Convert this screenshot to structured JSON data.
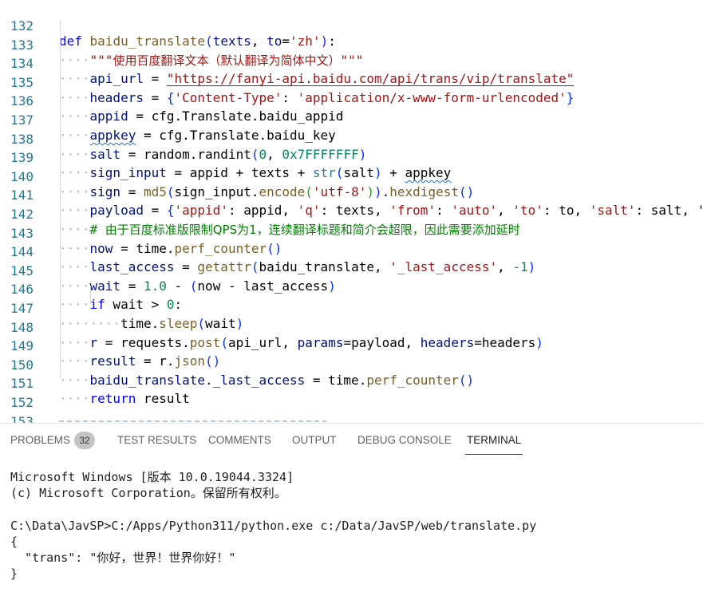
{
  "editor": {
    "line_numbers": [
      "132",
      "133",
      "134",
      "135",
      "136",
      "137",
      "138",
      "139",
      "140",
      "141",
      "142",
      "143",
      "144",
      "145",
      "146",
      "147",
      "148",
      "149",
      "150",
      "151",
      "152",
      "153"
    ],
    "code": {
      "l132": {
        "def": "def",
        "fname": "baidu_translate",
        "open": "(",
        "p1": "texts",
        ", ": ", ",
        "p2": "to",
        "eq": "=",
        "s": "'zh'",
        "close": ")",
        "colon": ":"
      },
      "l133": {
        "q1": "\"\"\"",
        "text": "使用百度翻译文本（默认翻译为简体中文）",
        "q2": "\"\"\""
      },
      "l134": {
        "var": "api_url",
        "op": " = ",
        "s": "\"https://fanyi-api.baidu.com/api/trans/vip/translate\""
      },
      "l135": {
        "var": "headers",
        "op": " = ",
        "ob": "{",
        "k": "'Content-Type'",
        "c": ": ",
        "v": "'application/x-www-form-urlencoded'",
        "cb": "}"
      },
      "l136": {
        "var": "appid",
        "op": " = ",
        "obj": "cfg.Translate.baidu_appid"
      },
      "l137": {
        "var": "appkey",
        "op": " = ",
        "obj": "cfg.Translate.baidu_key"
      },
      "l138": {
        "var": "salt",
        "op": " = ",
        "call": "random.randint",
        "ob": "(",
        "n1": "0",
        ", ": ", ",
        "n2": "0x7FFFFFFF",
        "cb": ")"
      },
      "l139": {
        "var": "sign_input",
        "op": " = ",
        "a": "appid + texts + ",
        "bi": "str",
        "ob": "(",
        "arg": "salt",
        "cb": ")",
        " + ": " + ",
        "b": "appkey"
      },
      "l140": {
        "var": "sign",
        "op": " = ",
        "fn": "md5",
        "o1": "(",
        "x": "sign_input.",
        "fn2": "encode",
        "o2": "(",
        "s": "'utf-8'",
        "c2": ")",
        "c1": ")",
        ".": ".",
        "fn3": "hexdigest",
        "o3": "()"
      },
      "l141": {
        "var": "payload",
        "op": " = ",
        "ob": "{",
        "k1": "'appid'",
        "r1": ": appid, ",
        "k2": "'q'",
        "r2": ": texts, ",
        "k3": "'from'",
        "r3": ": ",
        "v3": "'auto'",
        "r4": ", ",
        "k4": "'to'",
        "r5": ": to, ",
        "k5": "'salt'",
        "r6": ": salt, '"
      },
      "l142": {
        "hash": "# ",
        "text": "由于百度标准版限制QPS为1，连续翻译标题和简介会超限，因此需要添加延时"
      },
      "l143": {
        "var": "now",
        "op": " = ",
        "obj": "time.",
        "fn": "perf_counter",
        "p": "()"
      },
      "l144": {
        "var": "last_access",
        "op": " = ",
        "fn": "getattr",
        "ob": "(",
        "a": "baidu_translate, ",
        "s": "'_last_access'",
        ", ": ", ",
        "n": "-1",
        "cb": ")"
      },
      "l145": {
        "var": "wait",
        "op": " = ",
        "n": "1.0",
        " - ": " - ",
        "ob": "(",
        "a": "now - last_access",
        "cb": ")"
      },
      "l146": {
        "kw": "if",
        "a": " wait > ",
        "n": "0",
        "colon": ":"
      },
      "l147": {
        "obj": "time.",
        "fn": "sleep",
        "ob": "(",
        "a": "wait",
        "cb": ")"
      },
      "l148": {
        "var": "r",
        "op": " = ",
        "obj": "requests.",
        "fn": "post",
        "ob": "(",
        "a": "api_url, ",
        "p1": "params",
        "e1": "=payload, ",
        "p2": "headers",
        "e2": "=headers",
        "cb": ")"
      },
      "l149": {
        "var": "result",
        "op": " = ",
        "obj": "r.",
        "fn": "json",
        "p": "()"
      },
      "l150": {
        "var": "baidu_translate._last_access",
        "op": " = ",
        "obj": "time.",
        "fn": "perf_counter",
        "p": "()"
      },
      "l151": {
        "kw": "return",
        "a": " result"
      }
    }
  },
  "panel": {
    "tabs": [
      {
        "label": "PROBLEMS",
        "badge": "32"
      },
      {
        "label": "TEST RESULTS"
      },
      {
        "label": "COMMENTS"
      },
      {
        "label": "OUTPUT"
      },
      {
        "label": "DEBUG CONSOLE"
      },
      {
        "label": "TERMINAL",
        "active": true
      }
    ]
  },
  "terminal": {
    "lines": [
      "Microsoft Windows [版本 10.0.19044.3324]",
      "(c) Microsoft Corporation。保留所有权利。",
      "",
      "C:\\Data\\JavSP>C:/Apps/Python311/python.exe c:/Data/JavSP/web/translate.py",
      "{",
      "  \"trans\": \"你好，世界！世界你好！\"",
      "}"
    ]
  },
  "colors": {
    "keyword": "#0000ff",
    "function": "#795e26",
    "string": "#a31515",
    "number": "#098658",
    "comment": "#008000",
    "line_number": "#237893",
    "builtin": "#267f99"
  }
}
